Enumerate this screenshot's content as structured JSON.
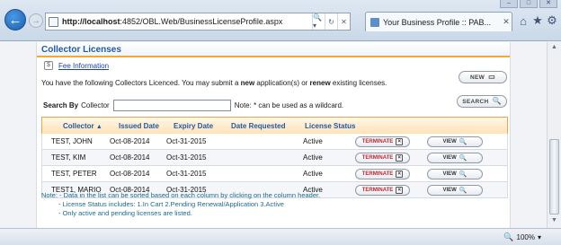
{
  "browser": {
    "url_host": "http://localhost",
    "url_rest": ":4852/OBL.Web/BusinessLicenseProfile.aspx",
    "tab_title": "Your Business Profile :: PAB...",
    "zoom": "100%"
  },
  "panel": {
    "title": "Collector Licenses",
    "fee_link": "Fee Information",
    "intro_part1": "You have the following Collectors Licenced. You may submit a ",
    "intro_new": "new",
    "intro_part2": " application(s) or ",
    "intro_renew": "renew",
    "intro_part3": " existing licenses.",
    "new_button": "NEW",
    "search_button": "SEARCH",
    "search_label": "Search By",
    "search_field_label": "Collector",
    "search_value": "",
    "search_note": "Note: * can be used as a wildcard."
  },
  "table": {
    "headers": {
      "collector": "Collector",
      "issued": "Issued Date",
      "expiry": "Expiry Date",
      "requested": "Date Requested",
      "status": "License Status"
    },
    "terminate_label": "TERMINATE",
    "view_label": "VIEW",
    "rows": [
      {
        "collector": "TEST, JOHN",
        "issued": "Oct-08-2014",
        "expiry": "Oct-31-2015",
        "requested": "",
        "status": "Active"
      },
      {
        "collector": "TEST, KIM",
        "issued": "Oct-08-2014",
        "expiry": "Oct-31-2015",
        "requested": "",
        "status": "Active"
      },
      {
        "collector": "TEST, PETER",
        "issued": "Oct-08-2014",
        "expiry": "Oct-31-2015",
        "requested": "",
        "status": "Active"
      },
      {
        "collector": "TEST1, MARIO",
        "issued": "Oct-08-2014",
        "expiry": "Oct-31-2015",
        "requested": "",
        "status": "Active"
      }
    ]
  },
  "notes": {
    "line1": "Note: - Data in the list can be sorted based on each column by clicking on the column header.",
    "line2": "- License Status includes: 1.In Cart   2.Pending Renewal/Application   3.Active",
    "line3": "- Only active and pending licenses are listed."
  }
}
